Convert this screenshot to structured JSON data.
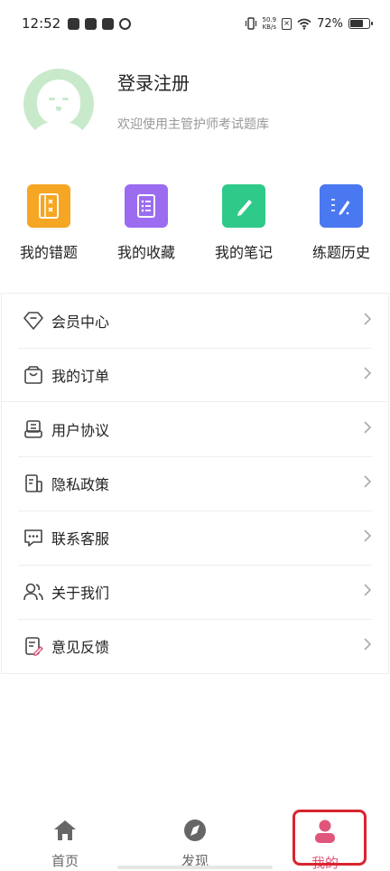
{
  "status_bar": {
    "time": "12:52",
    "net_speed_value": "50.9",
    "net_speed_unit": "KB/s",
    "battery": "72%",
    "battery_level": 0.72
  },
  "profile": {
    "title": "登录注册",
    "subtitle": "欢迎使用主管护师考试题库"
  },
  "quick_actions": [
    {
      "label": "我的错题",
      "icon": "wrong-questions-icon",
      "color": "#f5a623"
    },
    {
      "label": "我的收藏",
      "icon": "favorites-icon",
      "color": "#9b6cf0"
    },
    {
      "label": "我的笔记",
      "icon": "notes-icon",
      "color": "#2fc98a"
    },
    {
      "label": "练题历史",
      "icon": "practice-history-icon",
      "color": "#4a78f0"
    }
  ],
  "menu": {
    "group1": [
      {
        "label": "会员中心",
        "icon": "diamond-icon"
      },
      {
        "label": "我的订单",
        "icon": "shopping-bag-icon"
      }
    ],
    "group2": [
      {
        "label": "用户协议",
        "icon": "agreement-icon"
      },
      {
        "label": "隐私政策",
        "icon": "privacy-policy-icon"
      },
      {
        "label": "联系客服",
        "icon": "chat-icon"
      },
      {
        "label": "关于我们",
        "icon": "users-icon"
      },
      {
        "label": "意见反馈",
        "icon": "feedback-icon"
      }
    ]
  },
  "bottom_nav": [
    {
      "label": "首页",
      "icon": "home-icon"
    },
    {
      "label": "发现",
      "icon": "compass-icon"
    },
    {
      "label": "我的",
      "icon": "profile-icon",
      "active": true
    }
  ],
  "colors": {
    "active_tab": "#e0567a",
    "highlight_border": "#d9252e",
    "inactive_icon": "#666666"
  }
}
